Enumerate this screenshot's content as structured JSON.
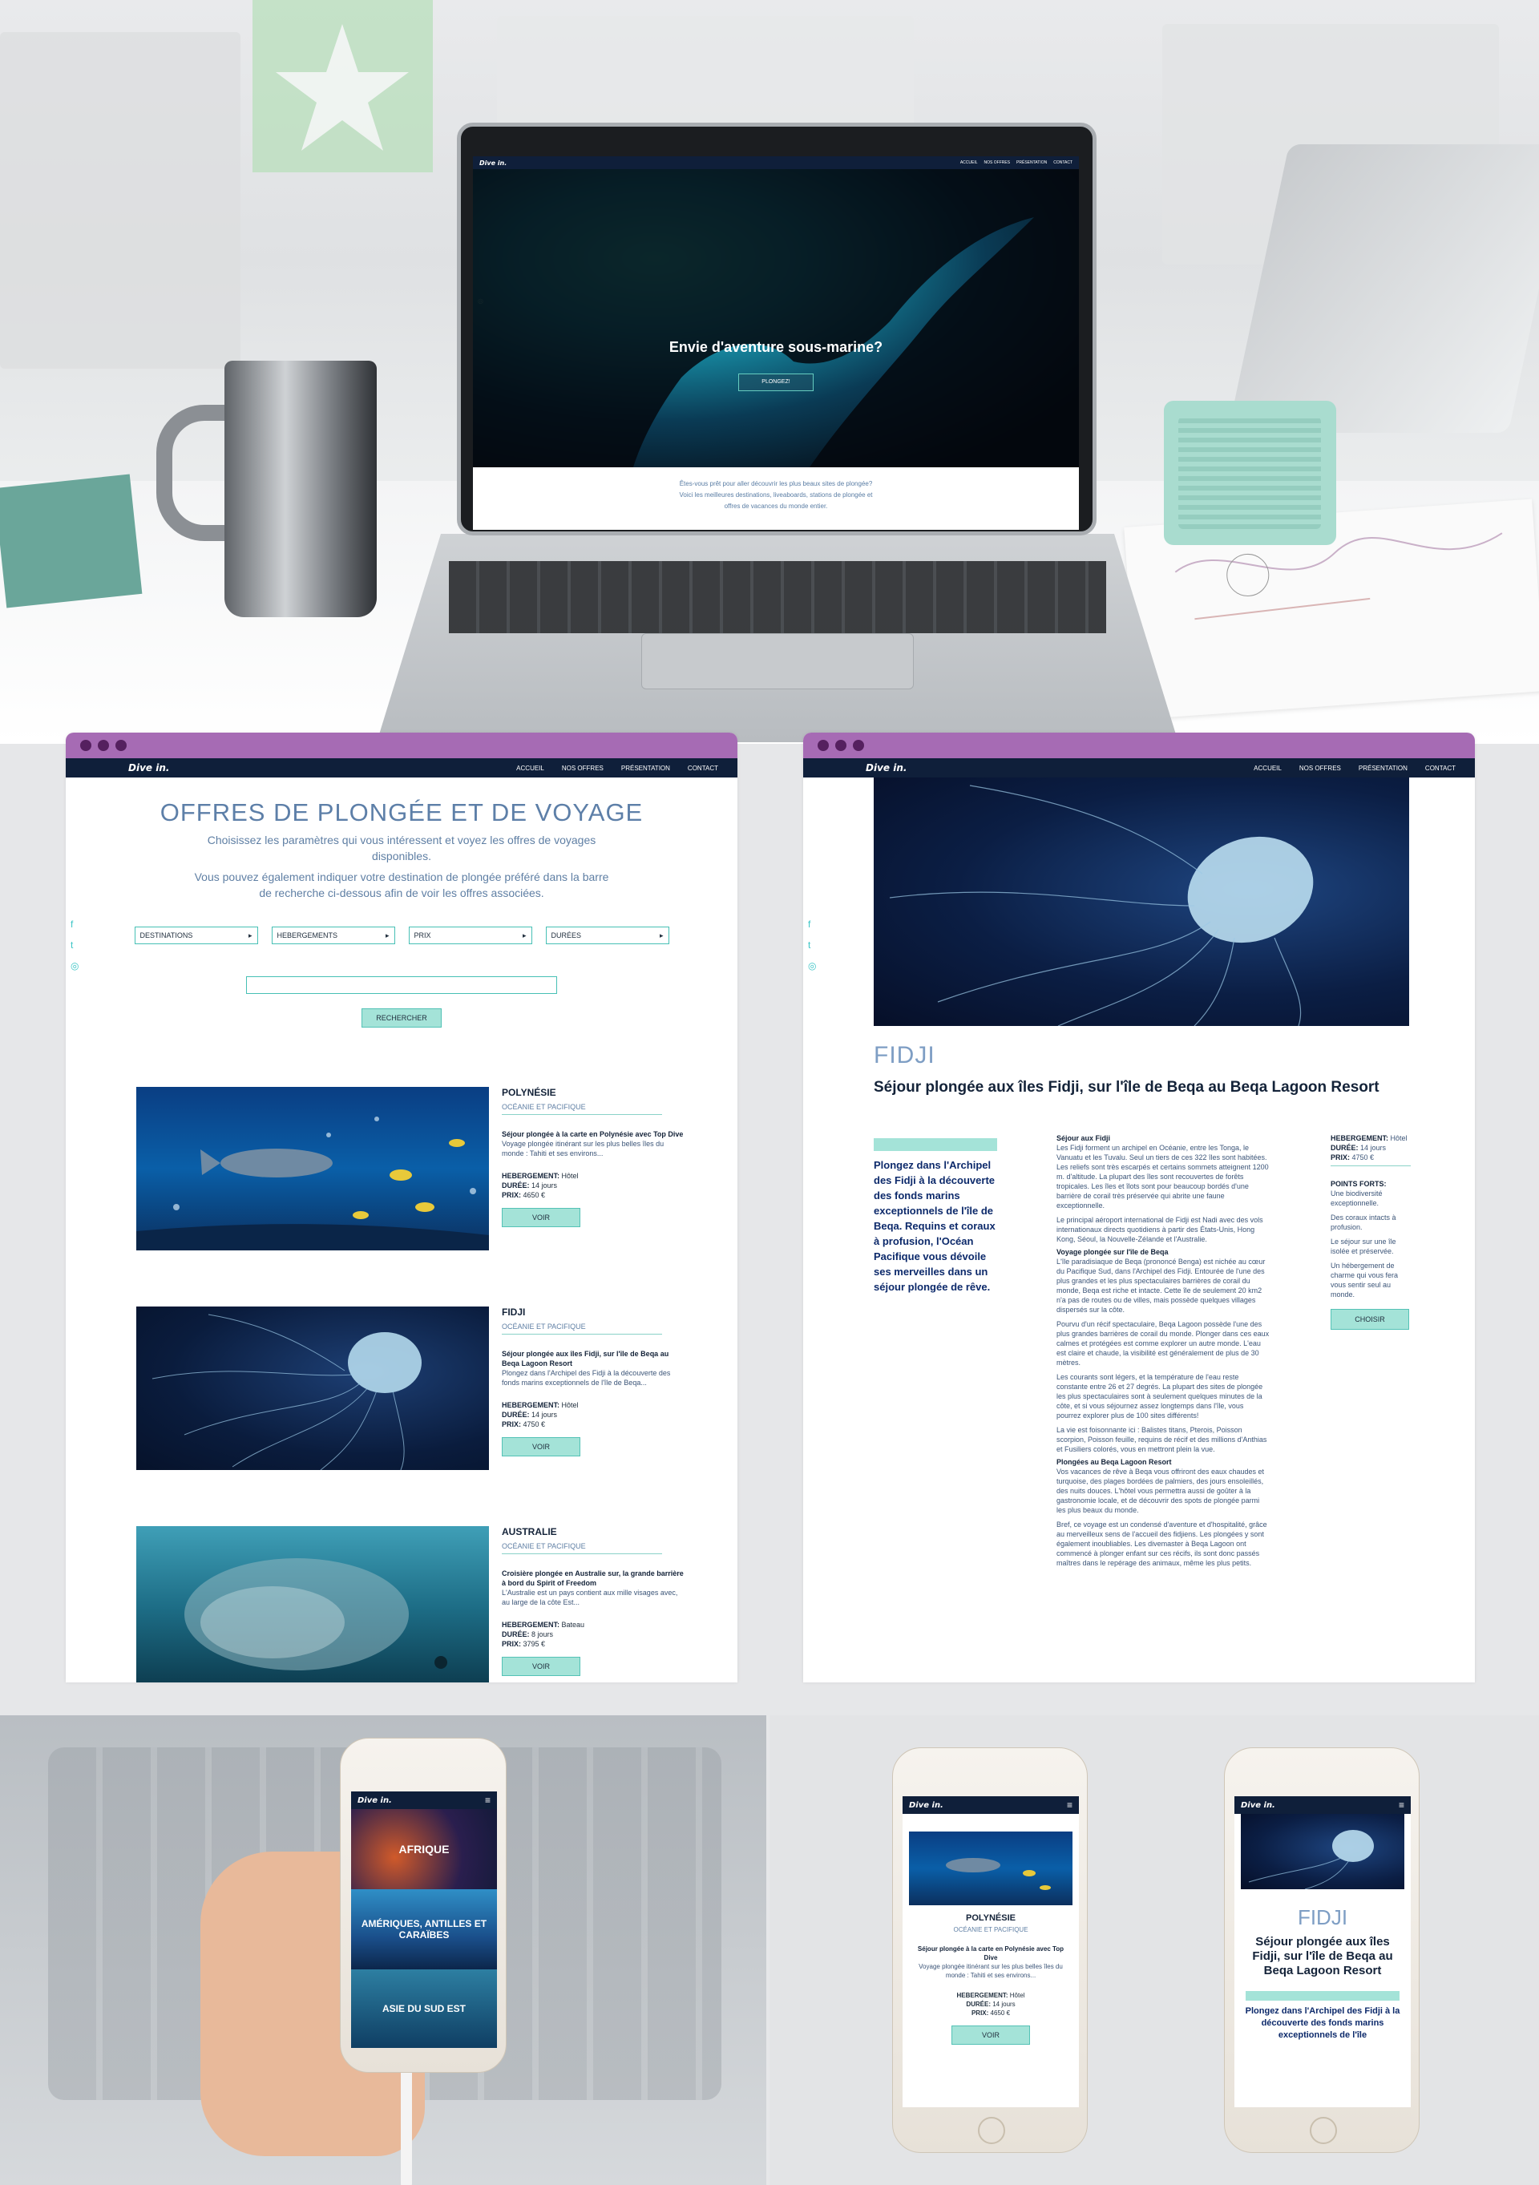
{
  "laptop_site": {
    "logo": "Dive in.",
    "nav": [
      "ACCUEIL",
      "NOS OFFRES",
      "PRÉSENTATION",
      "CONTACT"
    ],
    "hero_title": "Envie d'aventure sous-marine?",
    "hero_button": "PLONGEZ!",
    "intro_line1": "Êtes-vous prêt pour aller découvrir les plus beaux sites de plongée?",
    "intro_line2": "Voici les meilleures destinations, liveaboards, stations de plongée et",
    "intro_line3": "offres de vacances du monde entier."
  },
  "offers_page": {
    "logo": "Dive in.",
    "nav": [
      "ACCUEIL",
      "NOS OFFRES",
      "PRÉSENTATION",
      "CONTACT"
    ],
    "title": "OFFRES DE PLONGÉE ET DE VOYAGE",
    "desc1": "Choisissez les paramètres qui vous intéressent et voyez les offres de voyages",
    "desc2": "disponibles.",
    "desc3": "Vous pouvez également indiquer votre destination de plongée préféré dans la barre",
    "desc4": "de recherche ci-dessous afin de voir les offres associées.",
    "filters": [
      "DESTINATIONS",
      "HEBERGEMENTS",
      "PRIX",
      "DURÉES"
    ],
    "search_button": "RECHERCHER",
    "offers": [
      {
        "title": "POLYNÉSIE",
        "region": "OCÉANIE ET PACIFIQUE",
        "headline": "Séjour plongée à la carte en Polynésie avec Top Dive",
        "text": "Voyage plongée itinérant sur les plus belles îles du monde : Tahiti et ses environs...",
        "lodging_label": "HEBERGEMENT:",
        "lodging": "Hôtel",
        "duration_label": "DURÉE:",
        "duration": "14 jours",
        "price_label": "PRIX:",
        "price": "4650 €",
        "button": "VOIR"
      },
      {
        "title": "FIDJI",
        "region": "OCÉANIE ET PACIFIQUE",
        "headline": "Séjour plongée aux îles Fidji, sur l'île de Beqa au Beqa Lagoon Resort",
        "text": "Plongez dans l'Archipel des Fidji à la découverte des fonds marins exceptionnels de l'île de Beqa...",
        "lodging_label": "HEBERGEMENT:",
        "lodging": "Hôtel",
        "duration_label": "DURÉE:",
        "duration": "14 jours",
        "price_label": "PRIX:",
        "price": "4750 €",
        "button": "VOIR"
      },
      {
        "title": "AUSTRALIE",
        "region": "OCÉANIE ET PACIFIQUE",
        "headline": "Croisière plongée en Australie sur, la grande barrière à bord du Spirit of Freedom",
        "text": "L'Australie est un pays contient aux mille visages avec, au large de la côte Est...",
        "lodging_label": "HEBERGEMENT:",
        "lodging": "Bateau",
        "duration_label": "DURÉE:",
        "duration": "8 jours",
        "price_label": "PRIX:",
        "price": "3795 €",
        "button": "VOIR"
      }
    ]
  },
  "fidji_page": {
    "logo": "Dive in.",
    "nav": [
      "ACCUEIL",
      "NOS OFFRES",
      "PRÉSENTATION",
      "CONTACT"
    ],
    "title": "FIDJI",
    "subtitle": "Séjour plongée aux îles Fidji, sur l'île de Beqa au Beqa Lagoon Resort",
    "lead": "Plongez dans l'Archipel des Fidji à la découverte des fonds marins exceptionnels de l'île de Beqa. Requins et coraux à profusion, l'Océan Pacifique vous dévoile ses merveilles dans un séjour plongée de rêve.",
    "section1_title": "Séjour aux Fidji",
    "section1_text": "Les Fidji forment un archipel en Océanie, entre les Tonga, le Vanuatu et les Tuvalu. Seul un tiers de ces 322 îles sont habitées. Les reliefs sont très escarpés et certains sommets atteignent 1200 m. d'altitude. La plupart des îles sont recouvertes de forêts tropicales. Les îles et îlots sont pour beaucoup bordés d'une barrière de corail très préservée qui abrite une faune exceptionnelle.",
    "section1_text2": "Le principal aéroport international de Fidji est Nadi avec des vols internationaux directs quotidiens à partir des États-Unis, Hong Kong, Séoul, la Nouvelle-Zélande et l'Australie.",
    "section2_title": "Voyage plongée sur l'île de Beqa",
    "section2_text": "L'île paradisiaque de Beqa (prononcé Benga) est nichée au cœur du Pacifique Sud, dans l'Archipel des Fidji. Entourée de l'une des plus grandes et les plus spectaculaires barrières de corail du monde, Beqa est riche et intacte. Cette île de seulement 20 km2 n'a pas de routes ou de villes, mais possède quelques villages dispersés sur la côte.",
    "section2_text2": "Pourvu d'un récif spectaculaire, Beqa Lagoon possède l'une des plus grandes barrières de corail du monde. Plonger dans ces eaux calmes et protégées est comme explorer un autre monde. L'eau est claire et chaude, la visibilité est généralement de plus de 30 mètres.",
    "section2_text3": "Les courants sont légers, et la température de l'eau reste constante entre 26 et 27 degrés. La plupart des sites de plongée les plus spectaculaires sont à seulement quelques minutes de la côte, et si vous séjournez assez longtemps dans l'île, vous pourrez explorer plus de 100 sites différents!",
    "section2_text4": "La vie est foisonnante ici : Balistes titans, Pterois, Poisson scorpion, Poisson feuille, requins de récif et des millions d'Anthias et Fusiliers colorés, vous en mettront plein la vue.",
    "section3_title": "Plongées au Beqa Lagoon Resort",
    "section3_text": "Vos vacances de rêve à Beqa vous offriront des eaux chaudes et turquoise, des plages bordées de palmiers, des jours ensoleillés, des nuits douces. L'hôtel vous permettra aussi de goûter à la gastronomie locale, et de découvrir des spots de plongée parmi les plus beaux du monde.",
    "section3_text2": "Bref, ce voyage est un condensé d'aventure et d'hospitalité, grâce au merveilleux sens de l'accueil des fidjiens. Les plongées y sont également inoubliables. Les divemaster à Beqa Lagoon ont commencé à plonger enfant sur ces récifs, ils sont donc passés maîtres dans le repérage des animaux, même les plus petits.",
    "lodging_label": "HEBERGEMENT:",
    "lodging": "Hôtel",
    "duration_label": "DURÉE:",
    "duration": "14 jours",
    "price_label": "PRIX:",
    "price": "4750 €",
    "strengths_title": "POINTS FORTS:",
    "strength1": "Une biodiversité exceptionnelle.",
    "strength2": "Des coraux intacts à profusion.",
    "strength3": "Le séjour sur une île isolée et préservée.",
    "strength4": "Un hébergement de charme qui vous fera vous sentir seul au monde.",
    "button": "CHOISIR"
  },
  "phone_hand": {
    "logo": "Dive in.",
    "menu_icon": "hamburger-icon",
    "tiles": [
      "AFRIQUE",
      "AMÉRIQUES, ANTILLES ET CARAÏBES",
      "ASIE DU SUD EST"
    ]
  },
  "phone_offer": {
    "logo": "Dive in.",
    "title": "POLYNÉSIE",
    "region": "OCÉANIE ET PACIFIQUE",
    "headline": "Séjour plongée à la carte en Polynésie avec Top Dive",
    "text": "Voyage plongée itinérant sur les plus belles îles du monde : Tahiti et ses environs...",
    "lodging_label": "HEBERGEMENT:",
    "lodging": "Hôtel",
    "duration_label": "DURÉE:",
    "duration": "14 jours",
    "price_label": "PRIX:",
    "price": "4650 €",
    "button": "VOIR"
  },
  "phone_fidji": {
    "logo": "Dive in.",
    "title": "FIDJI",
    "subtitle": "Séjour plongée aux îles Fidji, sur l'île de Beqa au Beqa Lagoon Resort",
    "lead": "Plongez dans l'Archipel des Fidji à la découverte des fonds marins exceptionnels de l'île"
  },
  "colors": {
    "navy": "#0f1f3a",
    "teal": "#47c0b5",
    "teal_light": "#a4e3d8",
    "purple_bar": "#a66bb4",
    "title_blue": "#5d7fa8"
  }
}
